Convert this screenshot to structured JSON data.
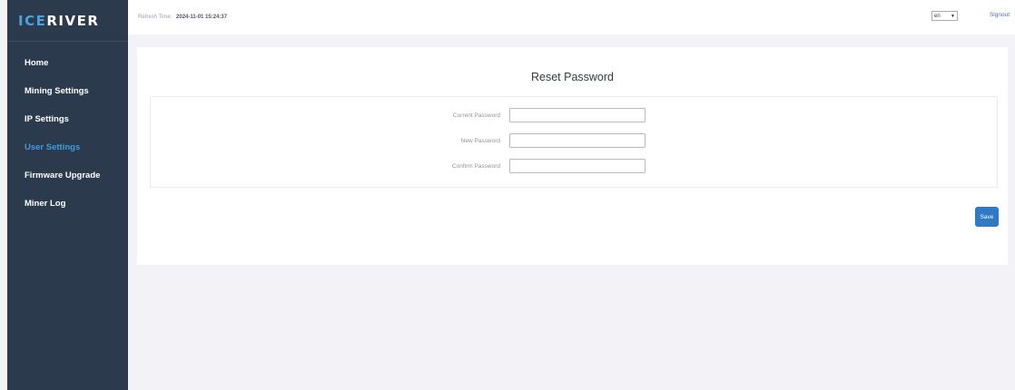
{
  "sidebar": {
    "logo_prefix": "ICE",
    "logo_suffix": "RIVER",
    "items": [
      {
        "label": "Home"
      },
      {
        "label": "Mining Settings"
      },
      {
        "label": "IP Settings"
      },
      {
        "label": "User Settings",
        "active": true
      },
      {
        "label": "Firmware Upgrade"
      },
      {
        "label": "Miner Log"
      }
    ]
  },
  "header": {
    "refresh_label": "Refresh Time:",
    "refresh_time": "2024-11-01 15:24:37",
    "language": "en",
    "signout": "Signout"
  },
  "main": {
    "title": "Reset Password",
    "fields": [
      {
        "label": "Current Password",
        "value": ""
      },
      {
        "label": "New Password",
        "value": ""
      },
      {
        "label": "Confirm Password",
        "value": ""
      }
    ],
    "save_label": "Save"
  },
  "colors": {
    "sidebar_bg": "#2c3a4e",
    "active_nav": "#3d9ce0",
    "save_button": "#2f79c5",
    "page_bg": "#f3f2f6"
  }
}
